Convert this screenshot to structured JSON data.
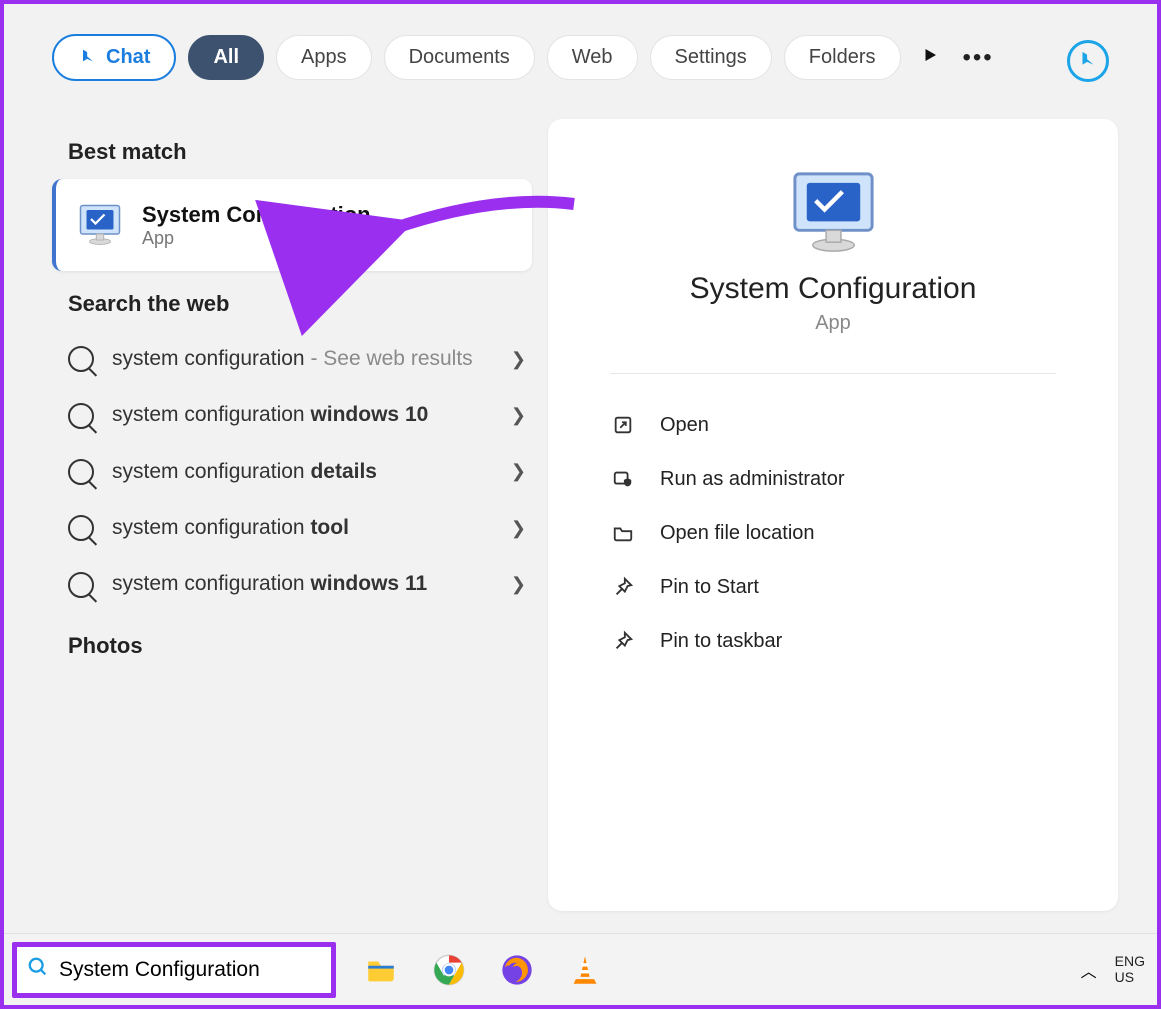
{
  "header": {
    "chat_label": "Chat",
    "filters": [
      "All",
      "Apps",
      "Documents",
      "Web",
      "Settings",
      "Folders"
    ],
    "active_filter_index": 0
  },
  "sections": {
    "best_match_label": "Best match",
    "search_web_label": "Search the web",
    "photos_label": "Photos"
  },
  "best_match": {
    "title": "System Configuration",
    "subtitle": "App"
  },
  "web_results": [
    {
      "prefix": "system configuration ",
      "suffix_muted": "- See web results",
      "suffix_bold": ""
    },
    {
      "prefix": "system configuration ",
      "suffix_muted": "",
      "suffix_bold": "windows 10"
    },
    {
      "prefix": "system configuration ",
      "suffix_muted": "",
      "suffix_bold": "details"
    },
    {
      "prefix": "system configuration ",
      "suffix_muted": "",
      "suffix_bold": "tool"
    },
    {
      "prefix": "system configuration ",
      "suffix_muted": "",
      "suffix_bold": "windows 11"
    }
  ],
  "details": {
    "title": "System Configuration",
    "subtitle": "App",
    "actions": [
      {
        "icon": "open",
        "label": "Open"
      },
      {
        "icon": "admin",
        "label": "Run as administrator"
      },
      {
        "icon": "folder",
        "label": "Open file location"
      },
      {
        "icon": "pin-start",
        "label": "Pin to Start"
      },
      {
        "icon": "pin-taskbar",
        "label": "Pin to taskbar"
      }
    ]
  },
  "taskbar": {
    "search_value": "System Configuration",
    "lang_line1": "ENG",
    "lang_line2": "US"
  }
}
